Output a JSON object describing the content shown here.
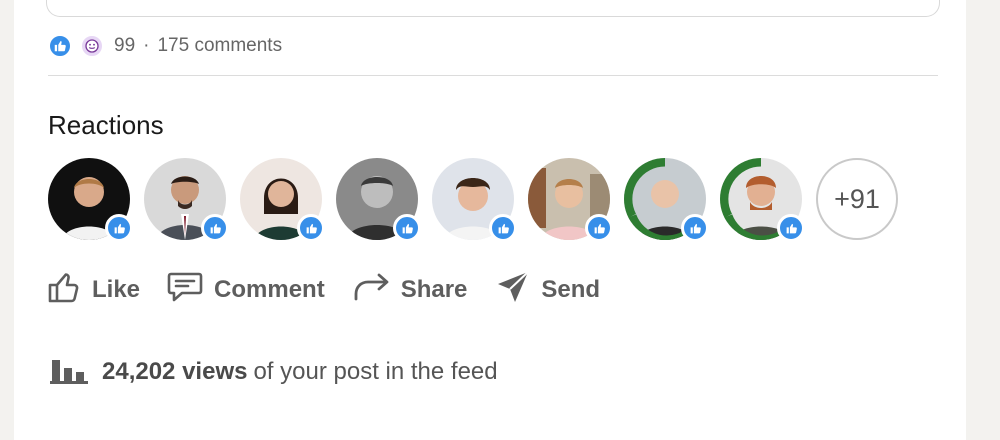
{
  "post": {
    "reaction_count": "99",
    "separator": "·",
    "comments": "175 comments"
  },
  "reactions_section": {
    "title": "Reactions",
    "more_count": "+91",
    "reactor_count_shown": 8
  },
  "actions": {
    "like": "Like",
    "comment": "Comment",
    "share": "Share",
    "send": "Send"
  },
  "analytics": {
    "views": "24,202 views",
    "views_suffix": "of your post in the feed"
  },
  "colors": {
    "like_blue": "#378fe9",
    "open_to_work_green": "#2e7d32",
    "text_gray": "#666666"
  },
  "icons": [
    "like-reaction-icon",
    "funny-reaction-icon",
    "thumbs-up-icon",
    "comment-icon",
    "share-arrow-icon",
    "send-icon",
    "bar-chart-icon"
  ]
}
